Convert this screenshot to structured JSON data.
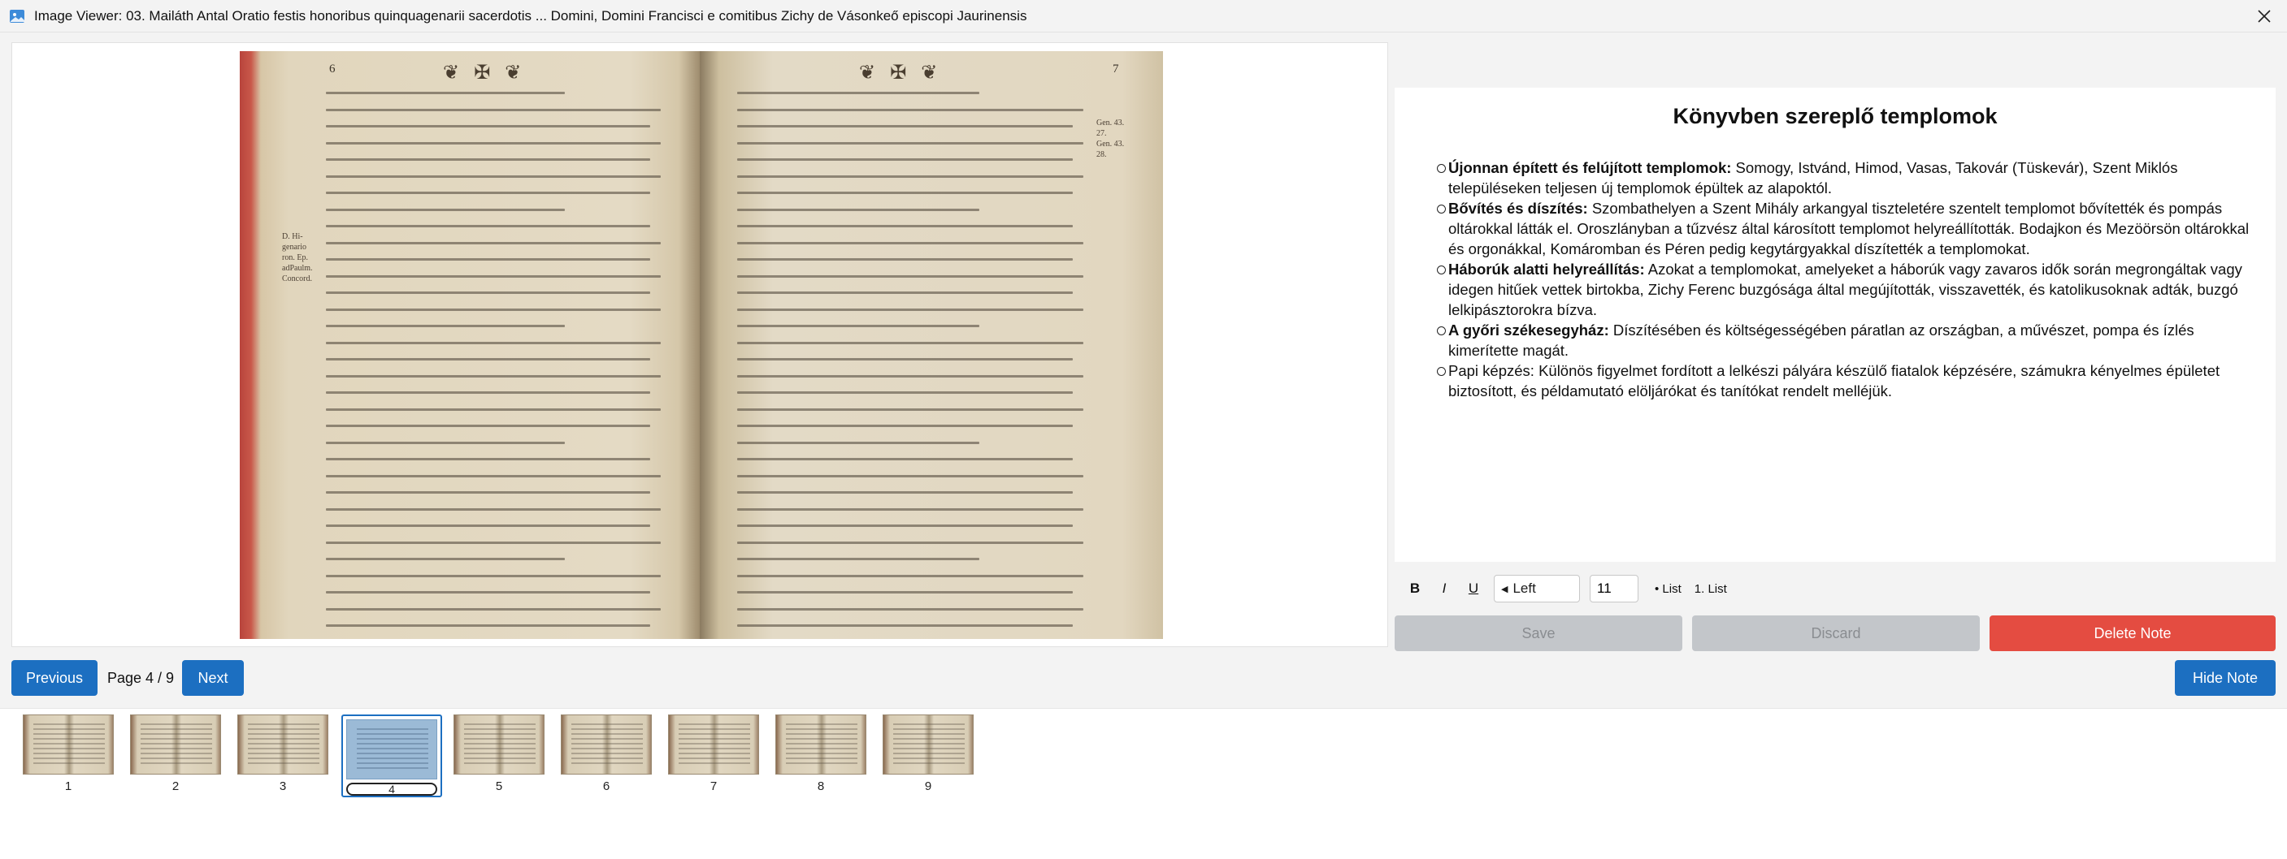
{
  "window": {
    "title": "Image Viewer: 03. Mailáth Antal Oratio festis honoribus quinquagenarii sacerdotis ... Domini, Domini Francisci e comitibus Zichy de Vásonkeő episcopi Jaurinensis",
    "app_icon": "image-viewer-icon",
    "close_icon": "close-icon"
  },
  "book": {
    "left_page_number": "6",
    "right_page_number": "7",
    "left_margin_note": "D. Hi-\ngenario\nron. Ep.\nadPaulm.\nConcord.",
    "right_margin_note": "Gen. 43.\n27.\nGen. 43.\n28."
  },
  "note": {
    "heading": "Könyvben szereplő templomok",
    "items": [
      {
        "label": "Újonnan épített és felújított templomok:",
        "text": " Somogy, István­d, Himod, Vasas, Takovár (Tüskevár), Szent Miklós településeken teljesen új templomok épültek az alapoktól."
      },
      {
        "label": "Bővítés és díszítés:",
        "text": " Szombathelyen a Szent Mihály arkangyal tiszteletére szentelt templomot bővítették és pompás oltárokkal látták el. Oroszlányban a tűzvész által károsított templomot helyreállították. Bodajkon és Mezöörsön oltárokkal és orgonákkal, Komáromban és Péren pedig kegytárgyakkal díszítették a templomokat."
      },
      {
        "label": "Háborúk alatti helyreállítás:",
        "text": " Azokat a templomokat, amelyeket a háborúk vagy zavaros idők során megrongáltak vagy idegen hitűek vettek birtokba, Zichy Ferenc buzgósága által megújították, visszavették, és katolikusoknak adták, buzgó lelkipásztorokra bízva."
      },
      {
        "label": "A győri székesegyház:",
        "text": " Díszítésében és költségességében páratlan az országban, a művészet, pompa és ízlés kimerítette magát."
      },
      {
        "label": "",
        "text": "Papi képzés: Különös figyelmet fordított a lelkészi pályára készülő fiatalok képzésére, számukra kényelmes épületet biztosított, és példamutató elöljárókat és tanítókat rendelt melléjük."
      }
    ]
  },
  "toolbar": {
    "bold": "B",
    "italic": "I",
    "underline": "U",
    "align_value": "Left",
    "font_size": "11",
    "bullet_list": "• List",
    "numbered_list": "1. List"
  },
  "actions": {
    "save": "Save",
    "discard": "Discard",
    "delete": "Delete Note"
  },
  "navigation": {
    "previous": "Previous",
    "page_indicator": "Page 4 / 9",
    "next": "Next",
    "hide_note": "Hide Note"
  },
  "thumbnails": [
    {
      "label": "1"
    },
    {
      "label": "2"
    },
    {
      "label": "3"
    },
    {
      "label": "4",
      "selected": true
    },
    {
      "label": "5"
    },
    {
      "label": "6"
    },
    {
      "label": "7"
    },
    {
      "label": "8"
    },
    {
      "label": "9"
    }
  ],
  "colors": {
    "primary": "#1c6fc1",
    "danger": "#e44c41",
    "disabled": "#c3c6ca"
  }
}
